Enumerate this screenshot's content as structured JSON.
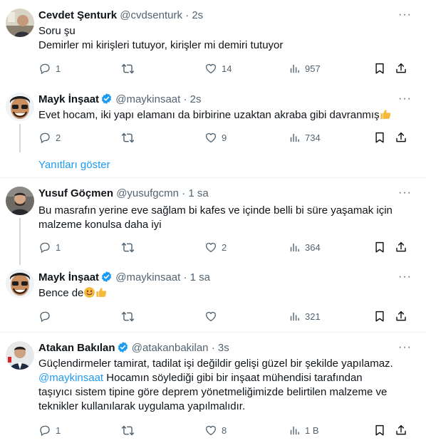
{
  "tweets": [
    {
      "name": "Cevdet Şenturk",
      "handle": "@cvdsenturk",
      "time": "2s",
      "lines": [
        "Soru şu",
        "Demirler mi kirişleri tutuyor, kirişler mi demiri tutuyor"
      ],
      "replies": "1",
      "retweets": "",
      "likes": "14",
      "views": "957"
    },
    {
      "name": "Mayk İnşaat",
      "handle": "@maykinsaat",
      "time": "2s",
      "verified": true,
      "lines": [
        "Evet hocam, iki yapı elamanı da birbirine uzaktan akraba gibi davranmış"
      ],
      "replies": "2",
      "retweets": "",
      "likes": "9",
      "views": "734"
    },
    {
      "name": "Yusuf Göçmen",
      "handle": "@yusufgcmn",
      "time": "1 sa",
      "lines": [
        "Bu masrafın yerine eve sağlam bi kafes ve içinde  belli bi süre yaşamak için",
        "malzeme konulsa daha iyi"
      ],
      "replies": "1",
      "retweets": "",
      "likes": "2",
      "views": "364"
    },
    {
      "name": "Mayk İnşaat",
      "handle": "@maykinsaat",
      "time": "1 sa",
      "verified": true,
      "lines": [
        "Bence de"
      ],
      "replies": "",
      "retweets": "",
      "likes": "",
      "views": "321"
    },
    {
      "name": "Atakan Bakılan",
      "handle": "@atakanbakilan",
      "time": "3s",
      "verified": true,
      "lines": [
        "Güçlendirmeler tamirat, tadilat işi değildir gelişi güzel bir şekilde yapılamaz.",
        "Hocamın söylediği gibi bir inşaat mühendisi tarafından",
        "taşıyıcı sistem tipine göre deprem yönetmeliğimizde belirtilen malzeme ve",
        "teknikler kullanılarak uygulama yapılmalıdır."
      ],
      "mention": "@maykinsaat",
      "replies": "1",
      "retweets": "",
      "likes": "8",
      "views": "1 B"
    }
  ],
  "show_replies_label": "Yanıtları göster",
  "separator": "·",
  "more_label": "···",
  "icons": [
    "reply-icon",
    "retweet-icon",
    "like-icon",
    "views-icon",
    "bookmark-icon",
    "share-icon",
    "verified-badge-icon"
  ],
  "colors": {
    "accent": "#1d9bf0",
    "muted": "#536471",
    "text": "#0f1419"
  }
}
